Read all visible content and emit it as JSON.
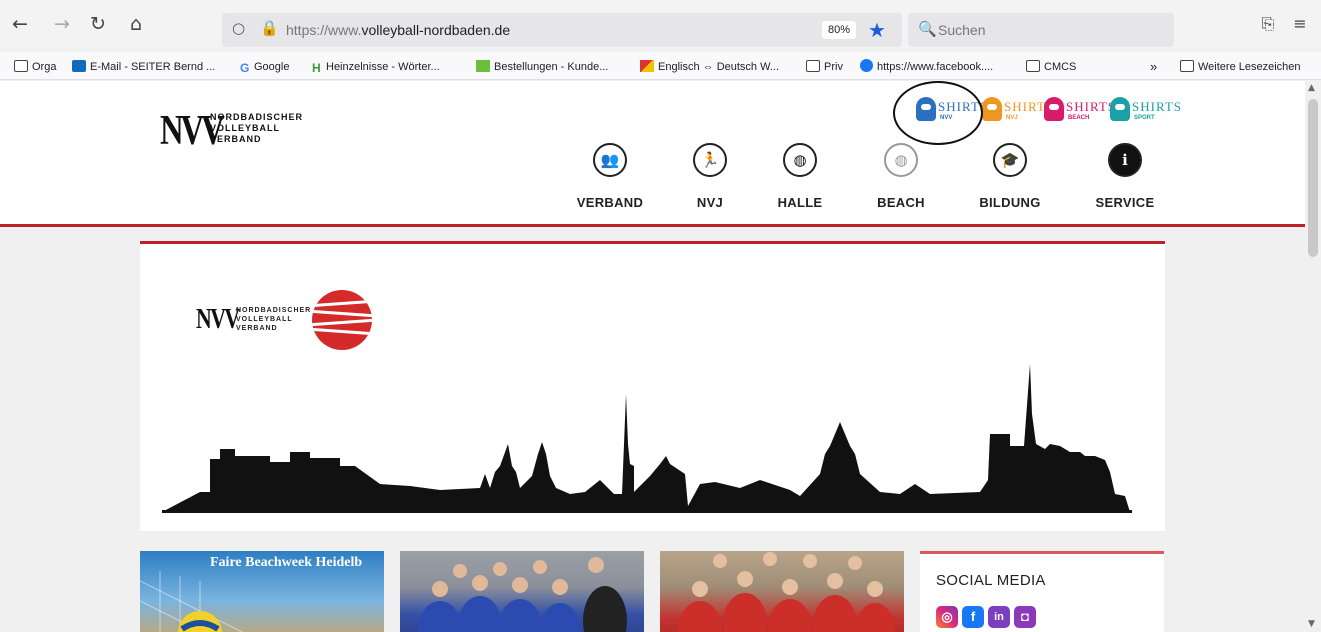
{
  "browser": {
    "url_prefix": "https://www.",
    "url_domain": "volleyball-nordbaden.de",
    "zoom": "80%",
    "search_placeholder": "Suchen"
  },
  "bookmarks": [
    {
      "label": "Orga",
      "icon": "folder-icon"
    },
    {
      "label": "E-Mail - SEITER Bernd ...",
      "icon": "outlook-icon"
    },
    {
      "label": "Google",
      "icon": "google-icon"
    },
    {
      "label": "Heinzelnisse - Wörter...",
      "icon": "heinzelnisse-icon"
    },
    {
      "label": "Bestellungen - Kunde...",
      "icon": "orders-icon"
    },
    {
      "label": "Englisch ⇔ Deutsch W...",
      "icon": "dictionary-icon"
    },
    {
      "label": "Priv",
      "icon": "folder-icon"
    },
    {
      "label": "https://www.facebook....",
      "icon": "facebook-icon"
    },
    {
      "label": "CMCS",
      "icon": "folder-icon"
    }
  ],
  "bookmarks_other": "Weitere Lesezeichen",
  "site": {
    "logo_big": "NVV",
    "logo_line1": "NORDBADISCHER",
    "logo_line2": "VOLLEYBALL",
    "logo_line3": "VERBAND",
    "shirts": [
      {
        "word": "SHIRTS",
        "sub": "NVV",
        "color": "#2a6fc0"
      },
      {
        "word": "SHIRTS",
        "sub": "NVJ",
        "color": "#f0961e"
      },
      {
        "word": "SHIRTS",
        "sub": "BEACH",
        "color": "#d81b6a"
      },
      {
        "word": "SHIRTS",
        "sub": "SPORT",
        "color": "#1aa0a6"
      }
    ],
    "nav": [
      {
        "label": "VERBAND",
        "icon": "people-icon",
        "glyph": "👥"
      },
      {
        "label": "NVJ",
        "icon": "player-icon",
        "glyph": "🏃"
      },
      {
        "label": "HALLE",
        "icon": "volleyball-icon",
        "glyph": "◍"
      },
      {
        "label": "BEACH",
        "icon": "beach-volleyball-icon",
        "glyph": "◍"
      },
      {
        "label": "BILDUNG",
        "icon": "graduation-cap-icon",
        "glyph": "🎓"
      },
      {
        "label": "SERVICE",
        "icon": "info-icon",
        "glyph": "ℹ"
      }
    ]
  },
  "cards": {
    "beach_title": "Faire Beachweek Heidelb",
    "social_title": "SOCIAL MEDIA",
    "social_icons": [
      "instagram-icon",
      "facebook-icon",
      "linkedin-icon",
      "twitch-icon"
    ]
  },
  "colors": {
    "accent": "#c0202a",
    "instagram": "#c13584",
    "facebook": "#1877f2",
    "linkedin": "#7b3fbf",
    "twitch": "#8a3ab9"
  }
}
